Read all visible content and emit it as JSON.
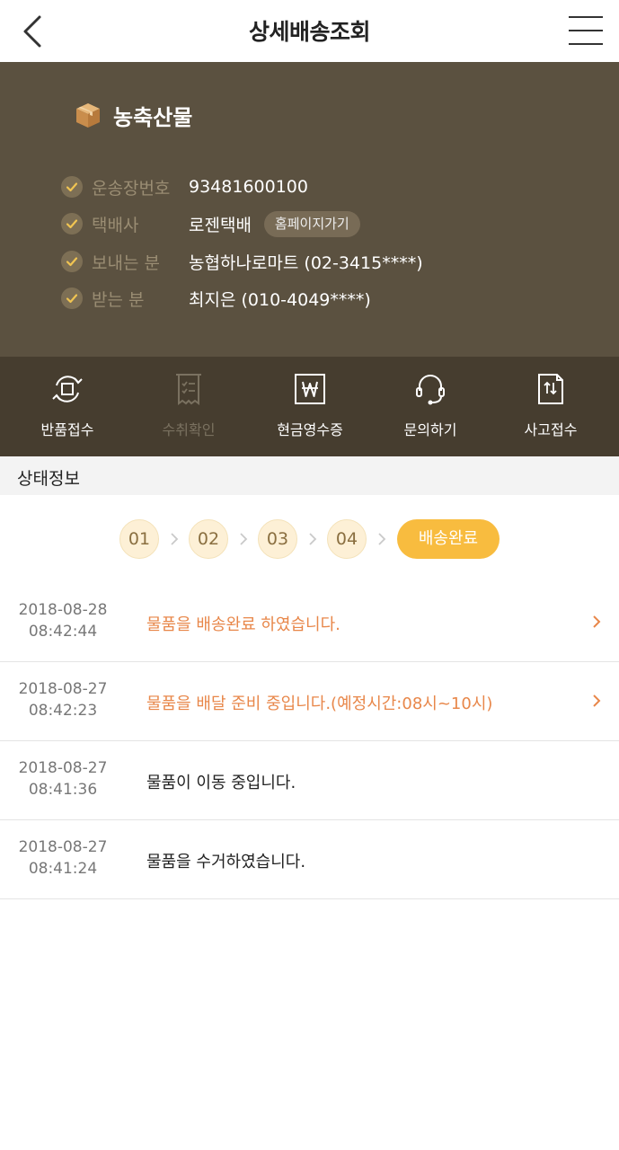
{
  "header": {
    "title": "상세배송조회",
    "back_icon": "chevron-left-icon",
    "menu_icon": "hamburger-menu-icon"
  },
  "info": {
    "product_icon": "package-box-icon",
    "product_name": "농축산물",
    "rows": [
      {
        "label": "운송장번호",
        "value": "93481600100"
      },
      {
        "label": "택배사",
        "value": "로젠택배",
        "button": "홈페이지가기"
      },
      {
        "label": "보내는 분",
        "value": "농협하나로마트 (02-3415****)"
      },
      {
        "label": "받는 분",
        "value": "최지은 (010-4049****)"
      }
    ]
  },
  "actions": [
    {
      "label": "반품접수",
      "icon": "return-cycle-icon",
      "enabled": true
    },
    {
      "label": "수취확인",
      "icon": "receipt-check-icon",
      "enabled": false
    },
    {
      "label": "현금영수증",
      "icon": "won-receipt-icon",
      "enabled": true
    },
    {
      "label": "문의하기",
      "icon": "headset-icon",
      "enabled": true
    },
    {
      "label": "사고접수",
      "icon": "report-document-icon",
      "enabled": true
    }
  ],
  "status": {
    "heading": "상태정보",
    "steps": [
      "01",
      "02",
      "03",
      "04"
    ],
    "current": "배송완료"
  },
  "tracking": [
    {
      "date": "2018-08-28",
      "time": "08:42:44",
      "message": "물품을 배송완료 하였습니다.",
      "highlight": true
    },
    {
      "date": "2018-08-27",
      "time": "08:42:23",
      "message": "물품을 배달 준비 중입니다.(예정시간:08시~10시)",
      "highlight": true
    },
    {
      "date": "2018-08-27",
      "time": "08:41:36",
      "message": "물품이 이동 중입니다.",
      "highlight": false
    },
    {
      "date": "2018-08-27",
      "time": "08:41:24",
      "message": "물품을 수거하였습니다.",
      "highlight": false
    }
  ],
  "colors": {
    "info_bg": "#5b5140",
    "action_bg": "#463d2f",
    "accent": "#f8bc3f",
    "highlight_text": "#e8874a"
  }
}
